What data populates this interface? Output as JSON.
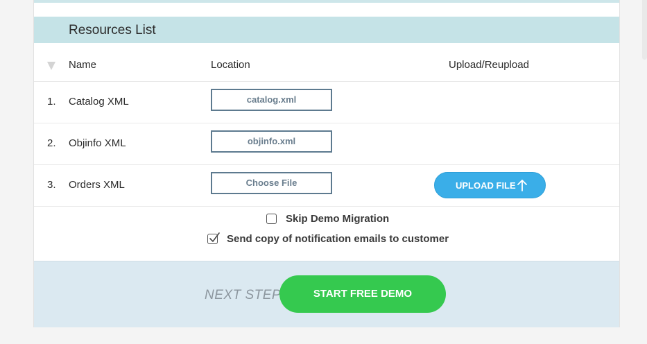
{
  "section": {
    "title": "Resources List"
  },
  "table": {
    "headers": {
      "name": "Name",
      "location": "Location",
      "upload": "Upload/Reupload"
    },
    "rows": [
      {
        "index": "1.",
        "name": "Catalog XML",
        "location": "catalog.xml"
      },
      {
        "index": "2.",
        "name": "Objinfo XML",
        "location": "objinfo.xml"
      },
      {
        "index": "3.",
        "name": "Orders XML",
        "location": "Choose File",
        "upload_label": "UPLOAD FILE"
      }
    ]
  },
  "options": {
    "skip_demo_migration": {
      "label": "Skip Demo Migration",
      "checked": false
    },
    "send_copy": {
      "label": "Send copy of notification emails to customer",
      "checked": true
    }
  },
  "footer": {
    "next_step_label": "NEXT STEP",
    "start_label": "START FREE DEMO"
  },
  "colors": {
    "header_bg": "#c5e3e7",
    "upload_button": "#3aaee8",
    "start_button": "#35c94f",
    "footer_bg": "#dbe9f1"
  }
}
